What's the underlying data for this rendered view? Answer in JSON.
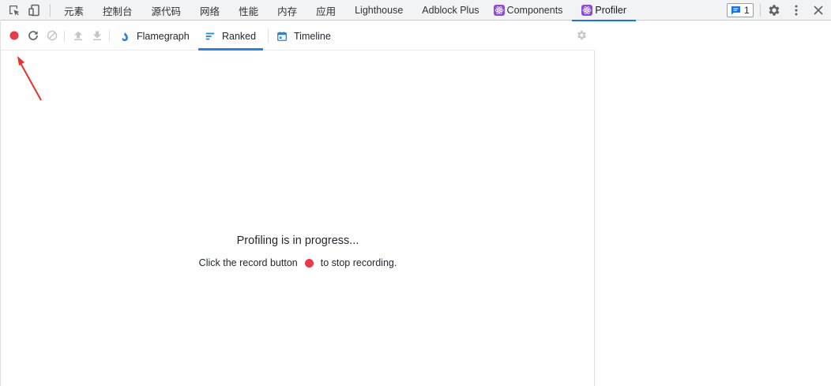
{
  "devtools": {
    "tabs": [
      {
        "label": "元素"
      },
      {
        "label": "控制台"
      },
      {
        "label": "源代码"
      },
      {
        "label": "网络"
      },
      {
        "label": "性能"
      },
      {
        "label": "内存"
      },
      {
        "label": "应用"
      },
      {
        "label": "Lighthouse"
      },
      {
        "label": "Adblock Plus"
      },
      {
        "label": "Components"
      },
      {
        "label": "Profiler"
      }
    ],
    "active_tab": "Profiler",
    "issues_count": "1"
  },
  "profiler": {
    "tabs": [
      {
        "label": "Flamegraph"
      },
      {
        "label": "Ranked"
      },
      {
        "label": "Timeline"
      }
    ],
    "active_tab": "Ranked",
    "recording": true,
    "message": {
      "title": "Profiling is in progress...",
      "before_icon": "Click the record button",
      "after_icon": "to stop recording."
    }
  },
  "colors": {
    "record_red": "#e93a4c",
    "accent_blue": "#2683e2",
    "annotation_red": "#e8322b",
    "react_badge": "#8d49d8"
  }
}
